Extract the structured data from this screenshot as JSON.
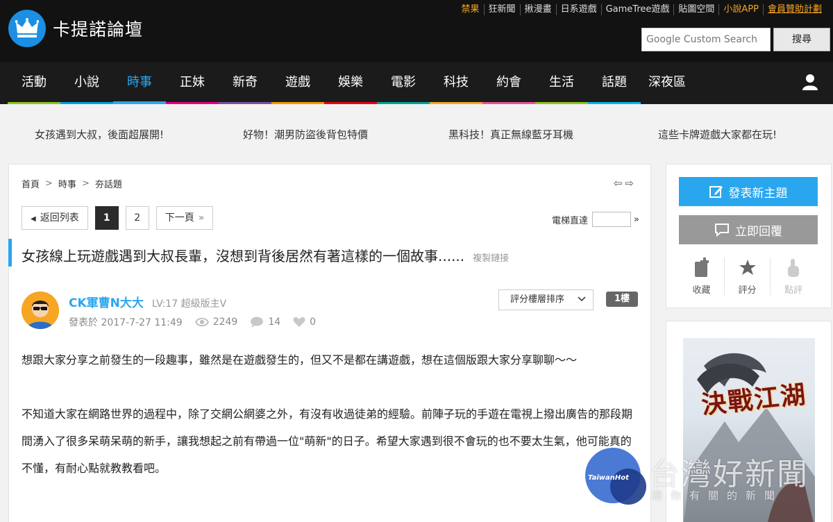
{
  "site": {
    "name": "卡提諾論壇"
  },
  "toplinks": [
    "禁果",
    "狂新聞",
    "揪漫畫",
    "日系遊戲",
    "GameTree遊戲",
    "貼圖空間",
    "小說APP",
    "會員贊助計劃"
  ],
  "search": {
    "placeholder": "Google Custom Search",
    "button": "搜尋"
  },
  "nav": {
    "items": [
      "活動",
      "小說",
      "時事",
      "正妹",
      "新奇",
      "遊戲",
      "娛樂",
      "電影",
      "科技",
      "約會",
      "生活",
      "話題",
      "深夜區"
    ],
    "active": "時事",
    "colors": [
      "#8fc31f",
      "#00a0e9",
      "#2aa6ef",
      "#e4007f",
      "#7d4ea3",
      "#f39800",
      "#e60012",
      "#00a29a",
      "#f6a623",
      "#e95295",
      "#8fc31f",
      "#00b7ee",
      "#1b1b1b"
    ]
  },
  "promos": [
    "女孩遇到大叔，後面超展開!",
    "好物！潮男防盜後背包特價",
    "黑科技！真正無線藍牙耳機",
    "這些卡牌遊戲大家都在玩!"
  ],
  "breadcrumb": [
    "首頁",
    "時事",
    "夯話題"
  ],
  "pager": {
    "back": "返回列表",
    "current": "1",
    "page2": "2",
    "next": "下一頁",
    "jump_label": "電梯直達"
  },
  "post": {
    "title": "女孩線上玩遊戲遇到大叔長輩，沒想到背後居然有著這樣的一個故事......",
    "copy_link": "複製鏈接",
    "author": "CK軍曹N大大",
    "level": "LV:17 超級版主V",
    "posted": "發表於 2017-7-27 11:49",
    "views": "2249",
    "comments": "14",
    "likes": "0",
    "sort_label": "評分樓層排序",
    "floor": "1樓",
    "paragraphs": [
      "想跟大家分享之前發生的一段趣事，雖然是在遊戲發生的，但又不是都在講遊戲，想在這個版跟大家分享聊聊～～",
      "不知道大家在網路世界的過程中，除了交網公網婆之外，有沒有收過徒弟的經驗。前陣子玩的手遊在電視上撥出廣告的那段期間湧入了很多呆萌呆萌的新手，讓我想起之前有帶過一位\"萌新\"的日子。希望大家遇到很不會玩的也不要太生氣，他可能真的不懂，有耐心點就教教看吧。"
    ]
  },
  "sidebar": {
    "new_topic": "發表新主題",
    "reply": "立即回覆",
    "actions": [
      "收藏",
      "評分",
      "點評"
    ]
  },
  "ad": {
    "title": "決戰江湖"
  },
  "watermark": {
    "logo": "TaiwanHot",
    "title": "台灣好新聞",
    "slogan": "跟你有關的新聞"
  }
}
